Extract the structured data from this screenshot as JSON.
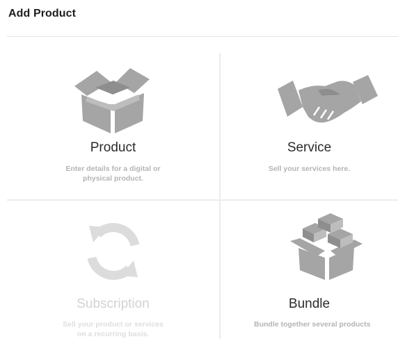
{
  "header": {
    "title": "Add Product"
  },
  "tiles": [
    {
      "name": "Product",
      "description_lines": [
        "Enter details for a digital or",
        "physical product."
      ],
      "icon": "box-icon"
    },
    {
      "name": "Service",
      "description_lines": [
        "Sell your services here."
      ],
      "icon": "handshake-icon"
    },
    {
      "name": "Subscription",
      "description_lines": [
        "Sell your product or services",
        "on a recurring basis."
      ],
      "icon": "refresh-icon",
      "state": "disabled"
    },
    {
      "name": "Bundle",
      "description_lines": [
        "Bundle together several products"
      ],
      "icon": "boxes-icon"
    }
  ],
  "colors": {
    "icon_gray": "#a5a5a5",
    "icon_disabled": "#dcdcdc",
    "text_dark": "#2a2a2a",
    "text_muted": "#b4b4b4"
  }
}
